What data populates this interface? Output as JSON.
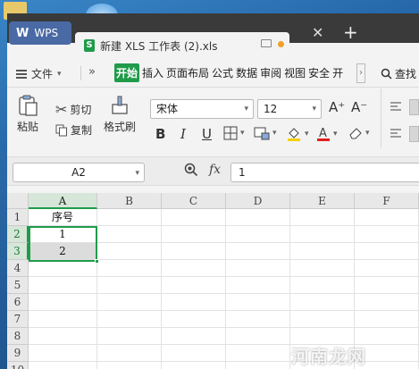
{
  "tabs": {
    "wps_label": "WPS",
    "document_title": "新建 XLS 工作表 (2).xls",
    "close_glyph": "✕",
    "add_glyph": "+"
  },
  "menu": {
    "file_label": "文件",
    "more_glyph": "»",
    "items": [
      "开始",
      "插入",
      "页面布局",
      "公式",
      "数据",
      "审阅",
      "视图",
      "安全",
      "开"
    ],
    "active_index": 0,
    "search_label": "查找"
  },
  "ribbon": {
    "paste_label": "粘贴",
    "cut_label": "剪切",
    "copy_label": "复制",
    "format_painter_label": "格式刷",
    "font_name": "宋体",
    "font_size": "12",
    "bold_glyph": "B",
    "italic_glyph": "I",
    "underline_glyph": "U",
    "grow_glyph": "A⁺",
    "shrink_glyph": "A⁻"
  },
  "formula_bar": {
    "cell_ref": "A2",
    "fx_label": "fx",
    "content": "1"
  },
  "sheet": {
    "columns": [
      "A",
      "B",
      "C",
      "D",
      "E",
      "F"
    ],
    "rows": [
      "1",
      "2",
      "3",
      "4",
      "5",
      "6",
      "7",
      "8",
      "9",
      "10"
    ],
    "cells": {
      "A1": "序号",
      "A2": "1",
      "A3": "2"
    }
  },
  "watermark": "河南龙网",
  "colors": {
    "accent": "#1f9b4a",
    "tabbar": "#3a3a3a",
    "wps_tab": "#4a6aa5"
  }
}
